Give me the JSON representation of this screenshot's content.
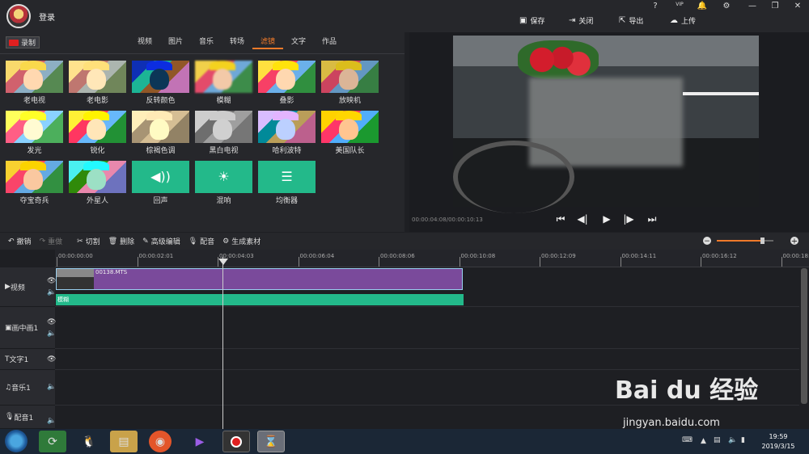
{
  "titlebar": {
    "login": "登录",
    "sys_icons": [
      "?",
      "VIP",
      "🔔",
      "⚙",
      "—",
      "❐",
      "✕"
    ],
    "actions": [
      {
        "label": "保存",
        "icon": "save-icon"
      },
      {
        "label": "关闭",
        "icon": "close-icon"
      },
      {
        "label": "导出",
        "icon": "export-icon"
      },
      {
        "label": "上传",
        "icon": "upload-icon"
      }
    ]
  },
  "record": {
    "label": "录制"
  },
  "tabs": [
    "视频",
    "图片",
    "音乐",
    "转场",
    "滤镜",
    "文字",
    "作品"
  ],
  "active_tab": "滤镜",
  "effects": [
    "老电视",
    "老电影",
    "反转颜色",
    "模糊",
    "叠影",
    "放映机",
    "发光",
    "锐化",
    "棕褐色调",
    "黑白电视",
    "哈利波特",
    "美国队长",
    "夺宝奇兵",
    "外星人",
    "回声",
    "混响",
    "均衡器"
  ],
  "audio_effect_glyphs": [
    "◀))",
    "☀",
    "☰"
  ],
  "preview": {
    "timecode": "00:00:04:08/00:00:10:13"
  },
  "toolbar": [
    {
      "label": "撤销",
      "icon": "undo-icon",
      "enabled": true
    },
    {
      "label": "重做",
      "icon": "redo-icon",
      "enabled": false
    },
    {
      "label": "切割",
      "icon": "scissors-icon",
      "enabled": true
    },
    {
      "label": "删除",
      "icon": "trash-icon",
      "enabled": true
    },
    {
      "label": "高级编辑",
      "icon": "pencil-icon",
      "enabled": true
    },
    {
      "label": "配音",
      "icon": "microphone-icon",
      "enabled": true
    },
    {
      "label": "生成素材",
      "icon": "reel-icon",
      "enabled": true
    }
  ],
  "zoom": {
    "minus": "−",
    "plus": "+",
    "level": 0.5
  },
  "ruler": [
    "00:00:00:00",
    "00:00:02:01",
    "00:00:04:03",
    "00:00:06:04",
    "00:00:08:06",
    "00:00:10:08",
    "00:00:12:09",
    "00:00:14:11",
    "00:00:16:12",
    "00:00:18:"
  ],
  "tracks": [
    {
      "label": "视频",
      "icon": "▶"
    },
    {
      "label": "画中画1",
      "icon": "▣"
    },
    {
      "label": "文字1",
      "icon": "T"
    },
    {
      "label": "音乐1",
      "icon": "♫"
    },
    {
      "label": "配音1",
      "icon": "🎙"
    }
  ],
  "clip": {
    "name": "00138.MTS",
    "effect": "模糊"
  },
  "taskbar": {
    "time": "19:59",
    "date": "2019/3/15"
  },
  "watermark": {
    "brand": "Bai du 经验",
    "url": "jingyan.baidu.com"
  },
  "colors": {
    "accent": "#f07a2a",
    "clip": "#7a4a9b",
    "effect": "#23b98a"
  }
}
